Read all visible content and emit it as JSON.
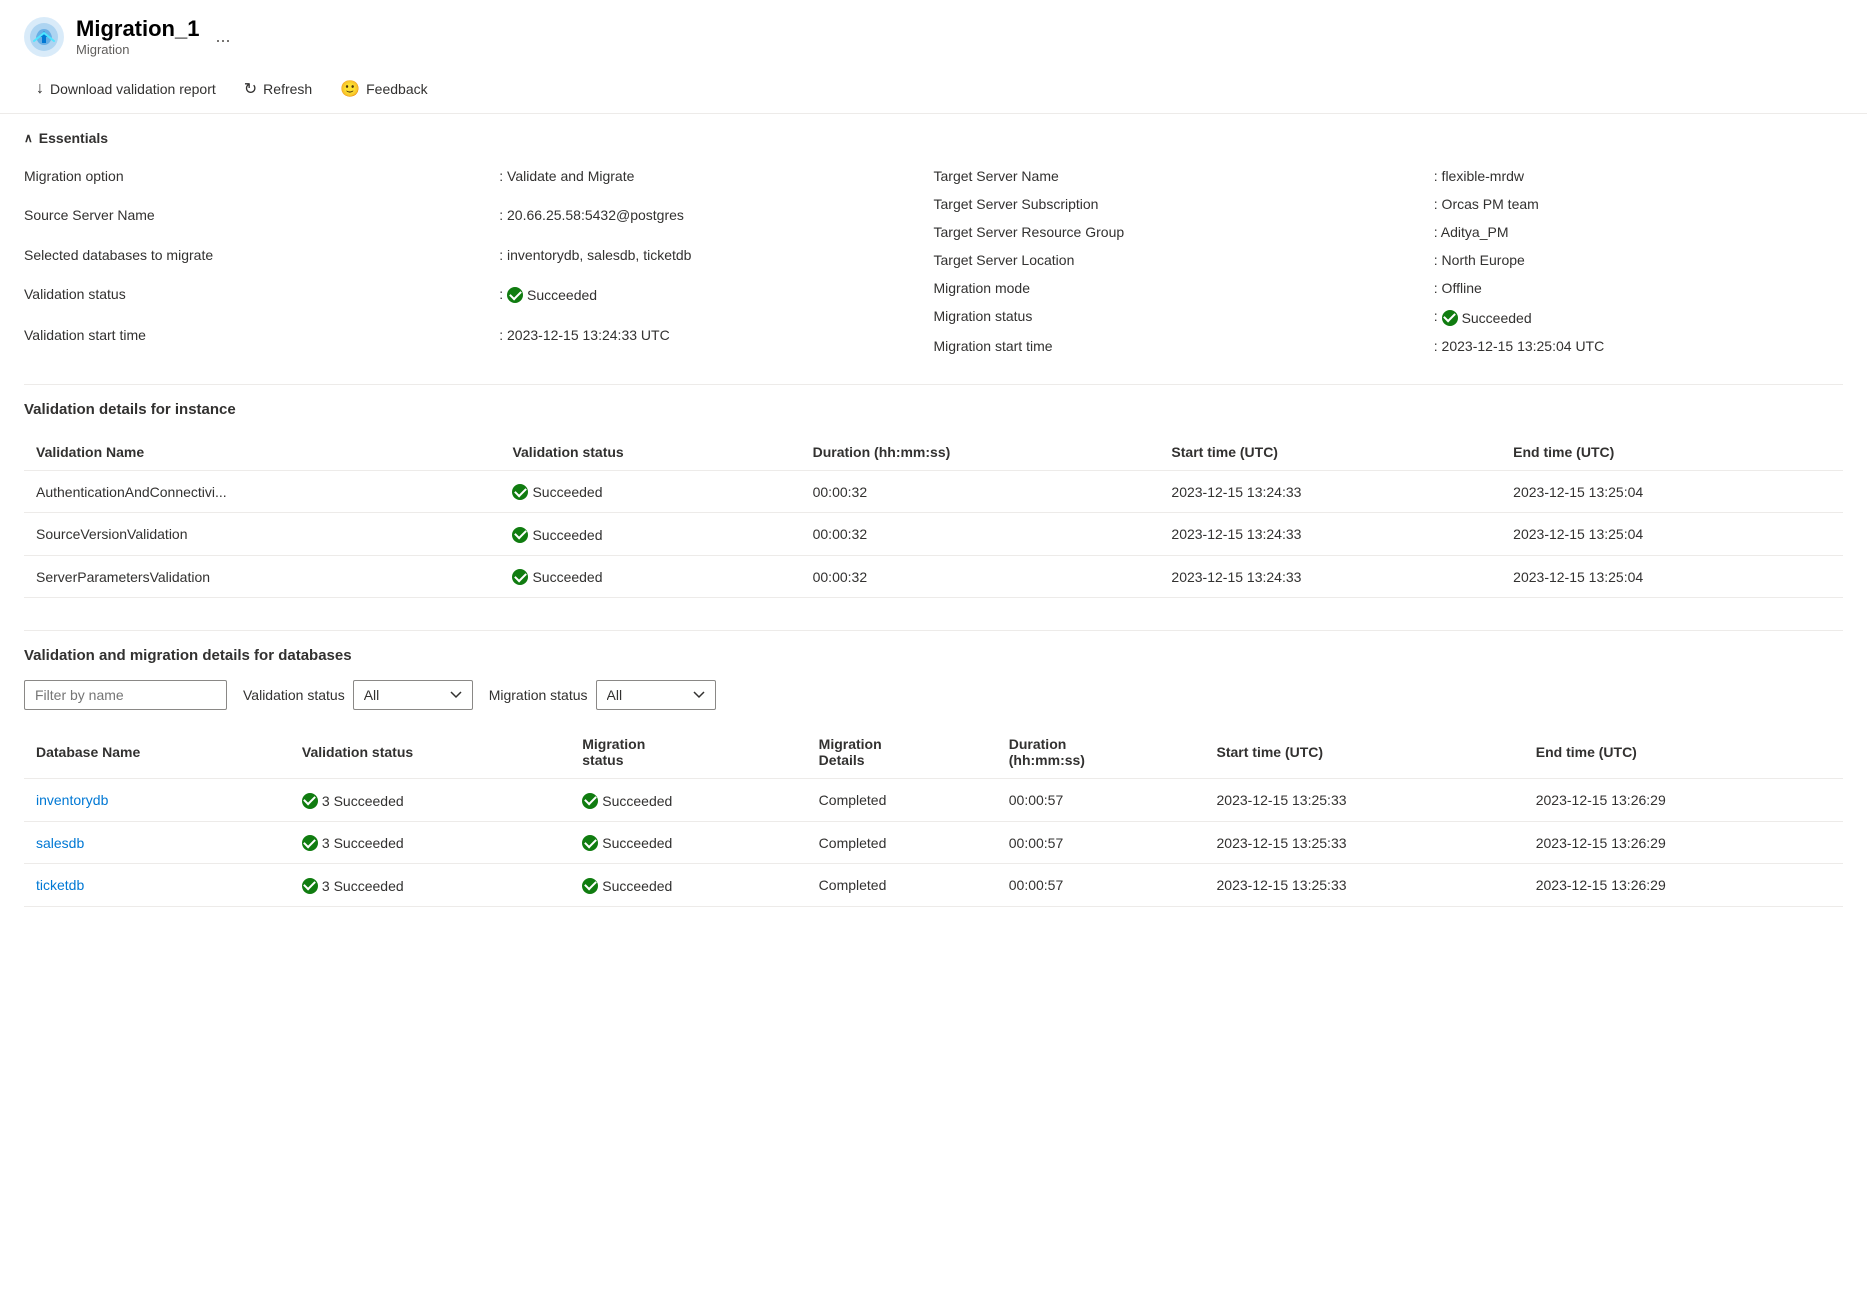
{
  "app": {
    "title": "Migration_1",
    "subtitle": "Migration",
    "more_label": "..."
  },
  "toolbar": {
    "download_label": "Download validation report",
    "refresh_label": "Refresh",
    "feedback_label": "Feedback"
  },
  "essentials": {
    "section_label": "Essentials",
    "left": [
      {
        "label": "Migration option",
        "value": "Validate and Migrate"
      },
      {
        "label": "Source Server Name",
        "value": "20.66.25.58:5432@postgres"
      },
      {
        "label": "Selected databases to migrate",
        "value": "inventorydb, salesdb, ticketdb"
      },
      {
        "label": "Validation status",
        "value": "Succeeded",
        "is_status": true
      },
      {
        "label": "Validation start time",
        "value": "2023-12-15 13:24:33 UTC"
      }
    ],
    "right": [
      {
        "label": "Target Server Name",
        "value": "flexible-mrdw"
      },
      {
        "label": "Target Server Subscription",
        "value": "Orcas PM team"
      },
      {
        "label": "Target Server Resource Group",
        "value": "Aditya_PM"
      },
      {
        "label": "Target Server Location",
        "value": "North Europe"
      },
      {
        "label": "Migration mode",
        "value": "Offline"
      },
      {
        "label": "Migration status",
        "value": "Succeeded",
        "is_status": true
      },
      {
        "label": "Migration start time",
        "value": "2023-12-15 13:25:04 UTC"
      }
    ]
  },
  "validation_instance": {
    "section_title": "Validation details for instance",
    "columns": [
      "Validation Name",
      "Validation status",
      "Duration (hh:mm:ss)",
      "Start time (UTC)",
      "End time (UTC)"
    ],
    "rows": [
      {
        "name": "AuthenticationAndConnectivi...",
        "status": "Succeeded",
        "duration": "00:00:32",
        "start": "2023-12-15 13:24:33",
        "end": "2023-12-15 13:25:04"
      },
      {
        "name": "SourceVersionValidation",
        "status": "Succeeded",
        "duration": "00:00:32",
        "start": "2023-12-15 13:24:33",
        "end": "2023-12-15 13:25:04"
      },
      {
        "name": "ServerParametersValidation",
        "status": "Succeeded",
        "duration": "00:00:32",
        "start": "2023-12-15 13:24:33",
        "end": "2023-12-15 13:25:04"
      }
    ]
  },
  "validation_databases": {
    "section_title": "Validation and migration details for databases",
    "filter_placeholder": "Filter by name",
    "validation_status_label": "Validation status",
    "migration_status_label": "Migration status",
    "filter_options": [
      "All"
    ],
    "columns": [
      "Database Name",
      "Validation status",
      "Migration status",
      "Migration Details",
      "Duration (hh:mm:ss)",
      "Start time (UTC)",
      "End time (UTC)"
    ],
    "rows": [
      {
        "name": "inventorydb",
        "validation_status": "3 Succeeded",
        "migration_status": "Succeeded",
        "migration_details": "Completed",
        "duration": "00:00:57",
        "start": "2023-12-15 13:25:33",
        "end": "2023-12-15 13:26:29"
      },
      {
        "name": "salesdb",
        "validation_status": "3 Succeeded",
        "migration_status": "Succeeded",
        "migration_details": "Completed",
        "duration": "00:00:57",
        "start": "2023-12-15 13:25:33",
        "end": "2023-12-15 13:26:29"
      },
      {
        "name": "ticketdb",
        "validation_status": "3 Succeeded",
        "migration_status": "Succeeded",
        "migration_details": "Completed",
        "duration": "00:00:57",
        "start": "2023-12-15 13:25:33",
        "end": "2023-12-15 13:26:29"
      }
    ]
  }
}
